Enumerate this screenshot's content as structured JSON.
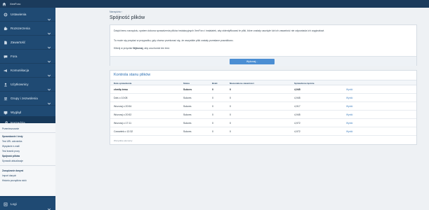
{
  "app": {
    "title": "XenForo"
  },
  "colors": {
    "topbar": "#1b3b5c",
    "sidebar": "#1f4a73",
    "accent": "#4b8ed3",
    "link": "#4b86c2"
  },
  "sidebar": {
    "items": [
      {
        "icon": "gear-icon",
        "label": "Ustawienia"
      },
      {
        "icon": "puzzle-icon",
        "label": "Rozszerzenia"
      },
      {
        "icon": "file-icon",
        "label": "Zawartość"
      },
      {
        "icon": "chat-icon",
        "label": "Fora"
      },
      {
        "icon": "megaphone-icon",
        "label": "Komunikacja"
      },
      {
        "icon": "user-icon",
        "label": "Użytkownicy"
      },
      {
        "icon": "users-icon",
        "label": "Grupy i zezwolenia"
      },
      {
        "icon": "palette-icon",
        "label": "Wygląd"
      },
      {
        "icon": "wrench-icon",
        "label": "Narzędzia"
      }
    ],
    "submenu": {
      "top": "Przemieszczanie",
      "section1": "Sprawdzanie i testy",
      "items1": [
        "Test URL odnośnika",
        "Wysyłanie e-maili",
        "Test bramki proxy",
        "Spójność plików",
        "Sprawdź aktualizacje"
      ],
      "section2": "Zarządzanie danymi",
      "items2": [
        "Import danych",
        "Historia porządków stoló"
      ]
    },
    "bottom": {
      "icon": "list-icon",
      "label": "Logi"
    }
  },
  "main": {
    "breadcrumb": "Narzędzia",
    "title": "Spójność plików",
    "description1": "Dzięki temu narzędziu, system dokona sprawdzenia plików instalacyjnych XenForo i instalatek, aby zidentyfikować te pliki, które zostały usunięte lub ich zawartość nie odpowiada ich oryginałowi.",
    "description2": "To może się przydać w przypadku, gdy chcesz przekonać się, że wszystkie pliki zostały przesłane prawidłowo.",
    "description3_pre": "Kliknij w przycisk ",
    "description3_bold": "Wykonaj",
    "description3_post": ", aby uruchomić ten test.",
    "run_button": "Wykonaj..."
  },
  "checks": {
    "title": "Kontrola stanu plików",
    "columns": [
      "Data sprawdzenia",
      "Status",
      "Braki",
      "Niezustalone zawartości",
      "Sprawdzone łącznie"
    ],
    "rows": [
      {
        "date": "chwilę temu",
        "status": "Sukces",
        "missing": "0",
        "unmatched": "0",
        "total": "4,945",
        "action": "Wyniki",
        "bold": true
      },
      {
        "date": "Dziś o 10:08",
        "status": "Sukces",
        "missing": "0",
        "unmatched": "0",
        "total": "4,945",
        "action": "Wyniki",
        "bold": false
      },
      {
        "date": "Wczoraj o 20:54",
        "status": "Sukces",
        "missing": "0",
        "unmatched": "0",
        "total": "4,917",
        "action": "Wyniki",
        "bold": false
      },
      {
        "date": "Wczoraj o 20:52",
        "status": "Sukces",
        "missing": "0",
        "unmatched": "0",
        "total": "4,945",
        "action": "Wyniki",
        "bold": false
      },
      {
        "date": "Wczoraj o 17:11",
        "status": "Sukces",
        "missing": "0",
        "unmatched": "0",
        "total": "4,972",
        "action": "Wyniki",
        "bold": false
      },
      {
        "date": "Czwartek o 12:32",
        "status": "Sukces",
        "missing": "0",
        "unmatched": "0",
        "total": "4,972",
        "action": "Wyniki",
        "bold": false
      }
    ],
    "footer": "Wszystkie elementy"
  }
}
